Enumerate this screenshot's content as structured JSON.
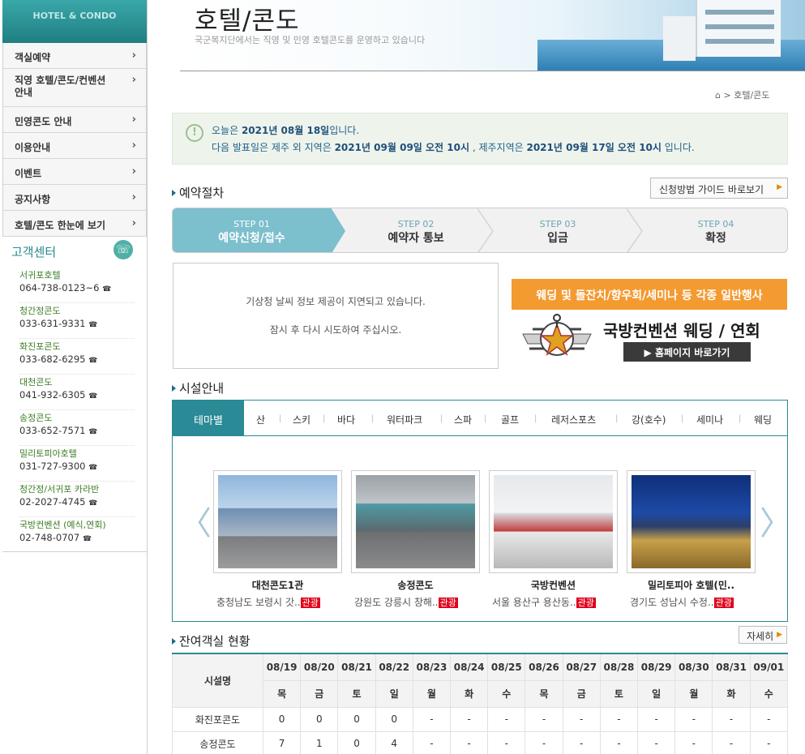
{
  "sidebar": {
    "brand": "HOTEL & CONDO",
    "menu": [
      {
        "label": "객실예약"
      },
      {
        "label": "직영 호텔/콘도/컨벤션 안내"
      },
      {
        "label": "민영콘도 안내"
      },
      {
        "label": "이용안내"
      },
      {
        "label": "이벤트"
      },
      {
        "label": "공지사항"
      },
      {
        "label": "호텔/콘도 한눈에 보기"
      }
    ],
    "chevron": "›",
    "customer_center": {
      "title": "고객센터",
      "icon": "phone-icon",
      "contacts": [
        {
          "name": "서귀포호텔",
          "phone": "064-738-0123~6"
        },
        {
          "name": "청간정콘도",
          "phone": "033-631-9331"
        },
        {
          "name": "화진포콘도",
          "phone": "033-682-6295"
        },
        {
          "name": "대천콘도",
          "phone": "041-932-6305"
        },
        {
          "name": "송정콘도",
          "phone": "033-652-7571"
        },
        {
          "name": "밀리토피아호텔",
          "phone": "031-727-9300"
        },
        {
          "name": "청간정/서귀포 카라반",
          "phone": "02-2027-4745"
        },
        {
          "name": "국방컨벤션 (예식,연회)",
          "phone": "02-748-0707"
        }
      ],
      "tel_glyph": "☎"
    }
  },
  "header": {
    "title": "호텔/콘도",
    "subtitle": "국군복지단에서는 직영 및 민영 호텔콘도를 운영하고 있습니다"
  },
  "breadcrumb": {
    "home_icon": "⌂",
    "sep": ">",
    "current": "호텔/콘도"
  },
  "notice": {
    "icon": "!",
    "line1_prefix": "오늘은 ",
    "today": "2021년 08월 18일",
    "line1_suffix": "입니다.",
    "line2_prefix": "다음 발표일은 제주 외 지역은 ",
    "next_mainland": "2021년 09월 09일 오전 10시",
    "line2_mid": " , 제주지역은 ",
    "next_jeju": "2021년 09월 17일 오전 10시",
    "line2_suffix": " 입니다."
  },
  "reservation": {
    "section_title": "예약절차",
    "guide_button": "신청방법 가이드 바로보기",
    "arrow": "▶",
    "steps": [
      {
        "num": "STEP 01",
        "label": "예약신청/접수",
        "active": true
      },
      {
        "num": "STEP 02",
        "label": "예약자 통보",
        "active": false
      },
      {
        "num": "STEP 03",
        "label": "입금",
        "active": false
      },
      {
        "num": "STEP 04",
        "label": "확정",
        "active": false
      }
    ]
  },
  "weather": {
    "line1": "기상청 날씨 정보 제공이 지연되고 있습니다.",
    "line2": "잠시 후 다시 시도하여 주십시오."
  },
  "ad": {
    "banner": "웨딩 및 돌잔치/향우회/세미나 등 각종 일반행사",
    "title": "국방컨벤션 웨딩 / 연회",
    "button": "▶ 홈페이지 바로가기"
  },
  "facilities": {
    "section_title": "시설안내",
    "theme_tab": "테마별",
    "tabs": [
      "산",
      "스키",
      "바다",
      "워터파크",
      "스파",
      "골프",
      "레저스포츠",
      "강(호수)",
      "세미나",
      "웨딩"
    ],
    "prev": "〈",
    "next": "〉",
    "cards": [
      {
        "name": "대천콘도1관",
        "location": "충청남도 보령시 갓..",
        "tag": "관광"
      },
      {
        "name": "송정콘도",
        "location": "강원도 강릉시 창해..",
        "tag": "관광"
      },
      {
        "name": "국방컨벤션",
        "location": "서울 용산구 용산동..",
        "tag": "관광"
      },
      {
        "name": "밀리토피아 호텔(민..",
        "location": "경기도 성남시 수정..",
        "tag": "관광"
      }
    ]
  },
  "availability": {
    "section_title": "잔여객실 현황",
    "more_button": "자세히",
    "facility_header": "시설명",
    "dates": [
      {
        "date": "08/19",
        "day": "목",
        "type": ""
      },
      {
        "date": "08/20",
        "day": "금",
        "type": ""
      },
      {
        "date": "08/21",
        "day": "토",
        "type": "sat"
      },
      {
        "date": "08/22",
        "day": "일",
        "type": "sun"
      },
      {
        "date": "08/23",
        "day": "월",
        "type": ""
      },
      {
        "date": "08/24",
        "day": "화",
        "type": ""
      },
      {
        "date": "08/25",
        "day": "수",
        "type": ""
      },
      {
        "date": "08/26",
        "day": "목",
        "type": ""
      },
      {
        "date": "08/27",
        "day": "금",
        "type": ""
      },
      {
        "date": "08/28",
        "day": "토",
        "type": "sat"
      },
      {
        "date": "08/29",
        "day": "일",
        "type": "sun"
      },
      {
        "date": "08/30",
        "day": "월",
        "type": ""
      },
      {
        "date": "08/31",
        "day": "화",
        "type": ""
      },
      {
        "date": "09/01",
        "day": "수",
        "type": ""
      }
    ],
    "rows": [
      {
        "name": "화진포콘도",
        "values": [
          "0",
          "0",
          "0",
          "0",
          "-",
          "-",
          "-",
          "-",
          "-",
          "-",
          "-",
          "-",
          "-",
          "-"
        ]
      },
      {
        "name": "송정콘도",
        "values": [
          "7",
          "1",
          "0",
          "4",
          "-",
          "-",
          "-",
          "-",
          "-",
          "-",
          "-",
          "-",
          "-",
          "-"
        ]
      }
    ]
  },
  "colors": {
    "accent": "#2a8a96",
    "step_active": "#7cbfcd",
    "ad_orange": "#f39a31",
    "tag_red": "#e0001b"
  }
}
